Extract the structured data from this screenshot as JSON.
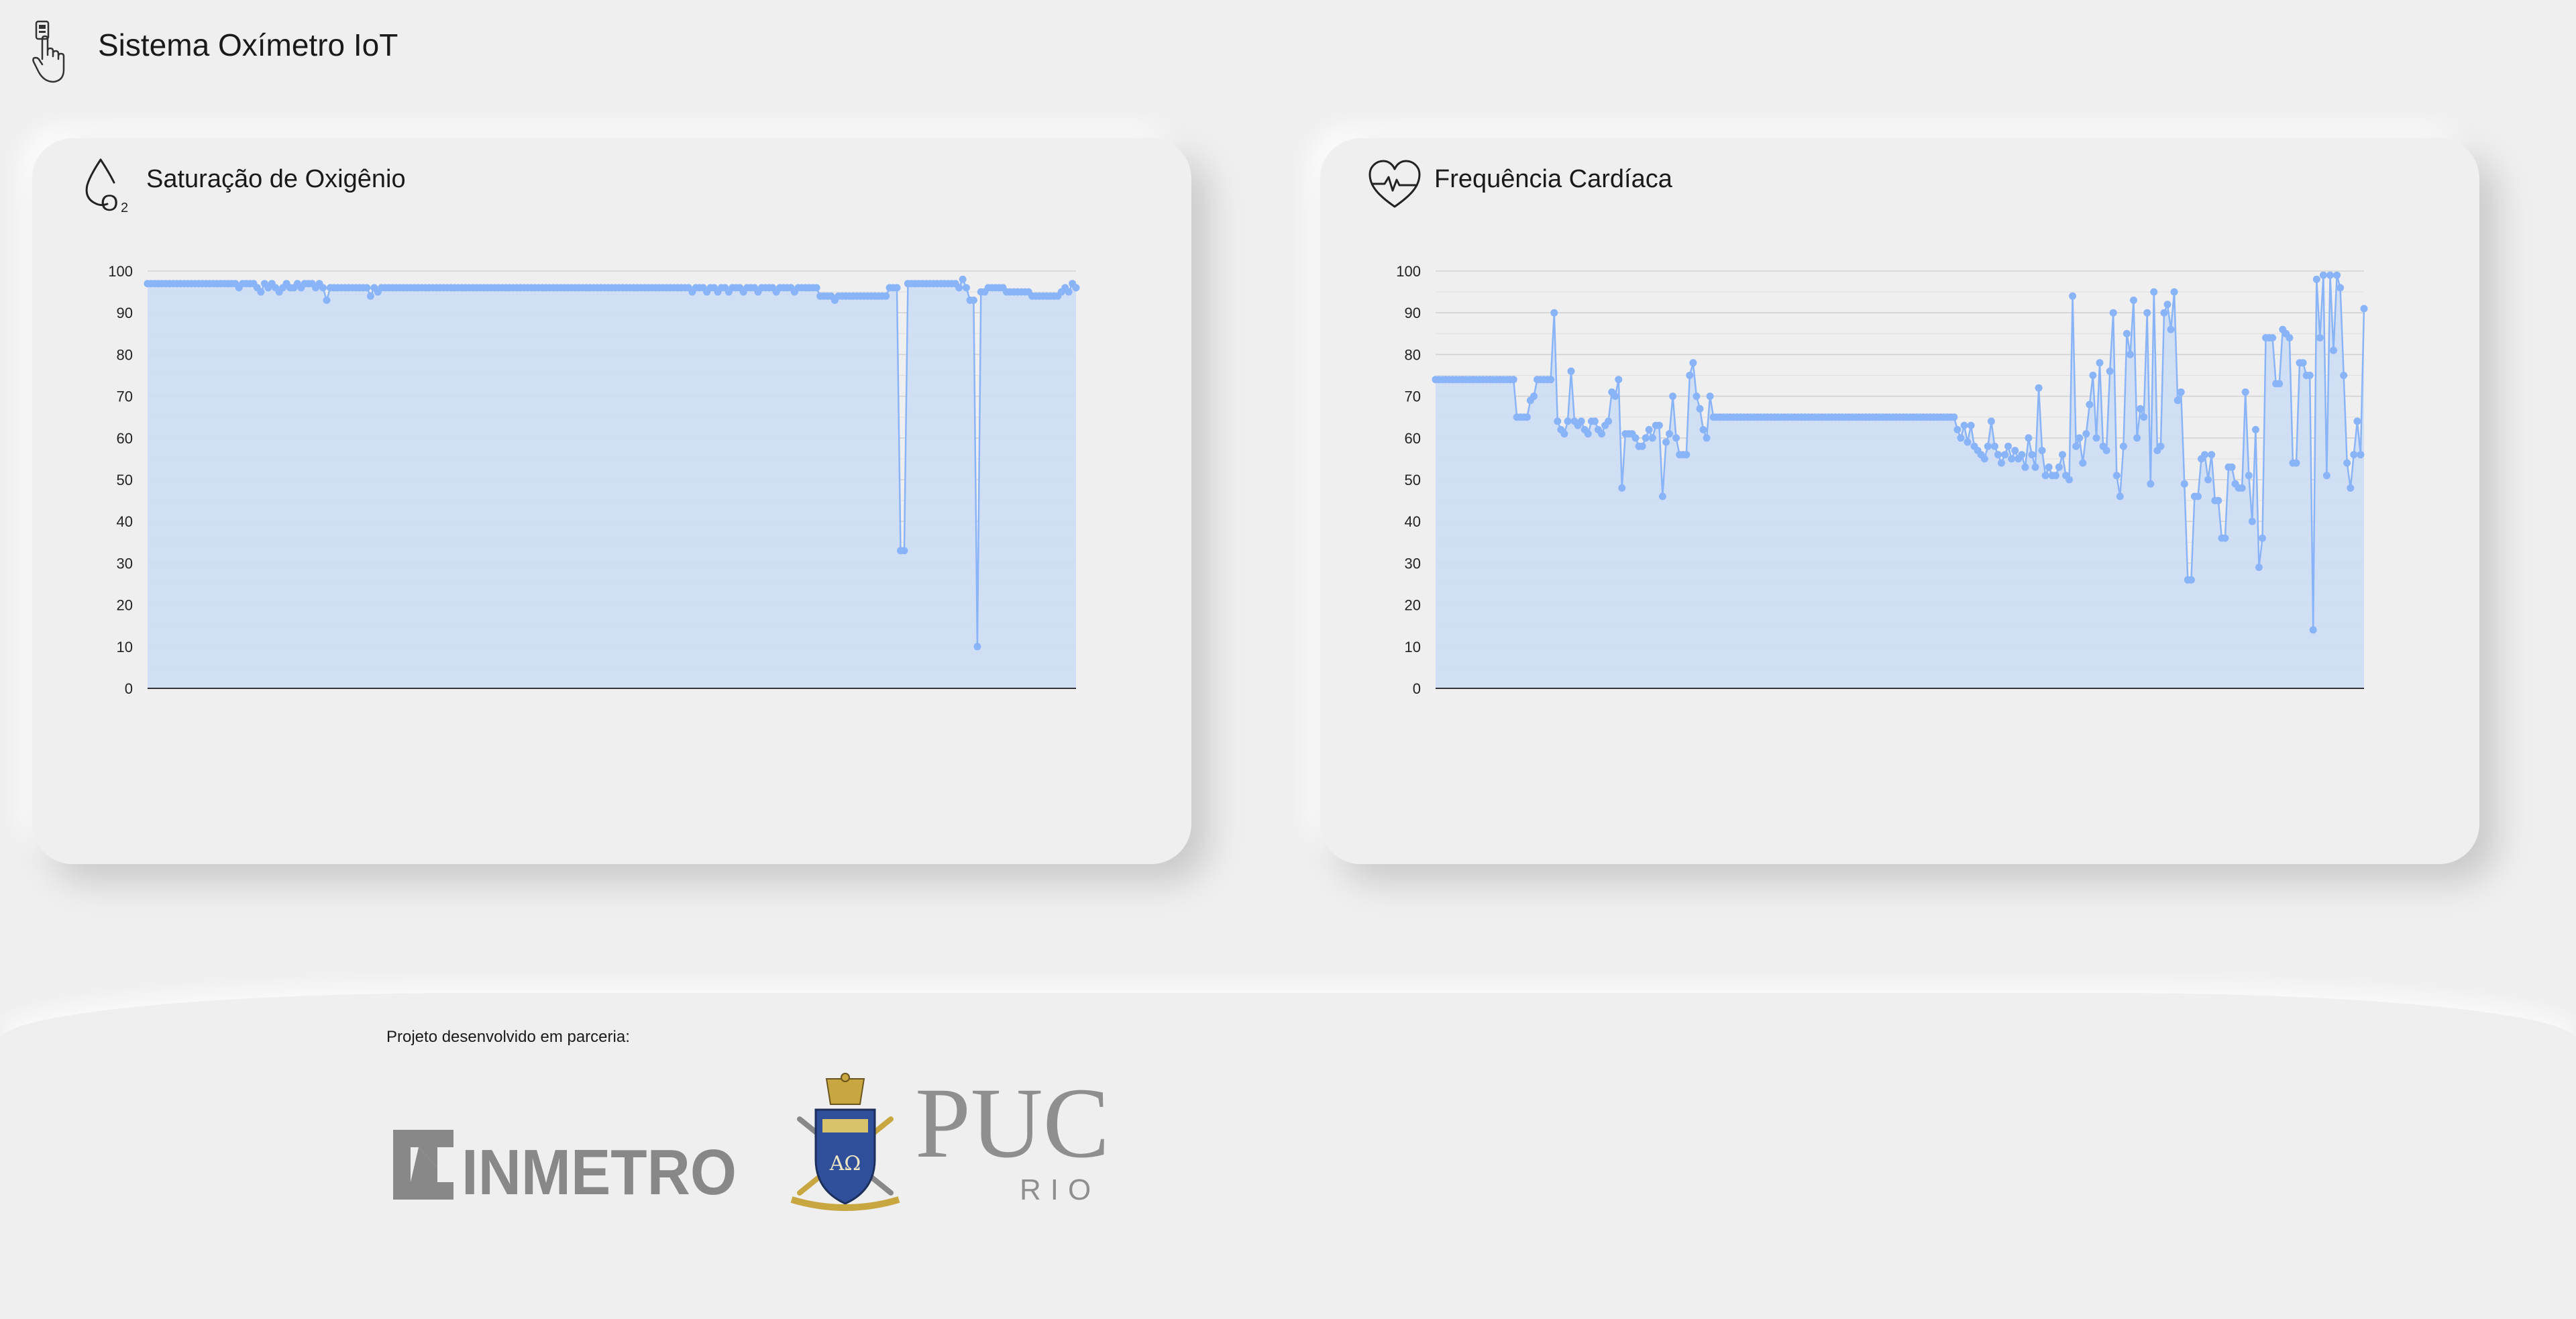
{
  "app": {
    "title": "Sistema Oxímetro IoT",
    "icon": "oximeter-finger-icon"
  },
  "cards": {
    "spo2": {
      "title": "Saturação de Oxigênio",
      "icon": "oxygen-drop-icon"
    },
    "heart": {
      "title": "Frequência Cardíaca",
      "icon": "heart-pulse-icon"
    }
  },
  "footer": {
    "caption": "Projeto desenvolvido em parceria:",
    "logos": {
      "inmetro": "INMETRO",
      "puc": "PUC",
      "puc_sub": "RIO",
      "puc_crest_motto": "ΑΩ"
    }
  },
  "colors": {
    "series": "#8ab4f8",
    "fill": "#cfddf4",
    "grid": "#cfcfcf",
    "axis": "#333333"
  },
  "chart_data": [
    {
      "type": "area",
      "title": "Saturação de Oxigênio",
      "xlabel": "",
      "ylabel": "",
      "ylim": [
        0,
        100
      ],
      "yticks": [
        0,
        10,
        20,
        30,
        40,
        50,
        60,
        70,
        80,
        90,
        100
      ],
      "grid": true,
      "series": [
        {
          "values": [
            97,
            97,
            97,
            97,
            97,
            97,
            97,
            97,
            97,
            97,
            97,
            97,
            97,
            97,
            97,
            97,
            97,
            97,
            97,
            97,
            97,
            97,
            97,
            97,
            97,
            96,
            97,
            97,
            97,
            97,
            96,
            95,
            97,
            96,
            97,
            96,
            95,
            96,
            97,
            96,
            96,
            97,
            96,
            97,
            97,
            97,
            96,
            97,
            96,
            93,
            96,
            96,
            96,
            96,
            96,
            96,
            96,
            96,
            96,
            96,
            96,
            94,
            96,
            95,
            96,
            96,
            96,
            96,
            96,
            96,
            96,
            96,
            96,
            96,
            96,
            96,
            96,
            96,
            96,
            96,
            96,
            96,
            96,
            96,
            96,
            96,
            96,
            96,
            96,
            96,
            96,
            96,
            96,
            96,
            96,
            96,
            96,
            96,
            96,
            96,
            96,
            96,
            96,
            96,
            96,
            96,
            96,
            96,
            96,
            96,
            96,
            96,
            96,
            96,
            96,
            96,
            96,
            96,
            96,
            96,
            96,
            96,
            96,
            96,
            96,
            96,
            96,
            96,
            96,
            96,
            96,
            96,
            96,
            96,
            96,
            96,
            96,
            96,
            96,
            96,
            96,
            96,
            96,
            96,
            96,
            96,
            96,
            96,
            96,
            95,
            96,
            96,
            96,
            95,
            96,
            96,
            95,
            96,
            96,
            95,
            96,
            96,
            96,
            95,
            96,
            96,
            96,
            95,
            96,
            96,
            96,
            96,
            95,
            96,
            96,
            96,
            96,
            95,
            96,
            96,
            96,
            96,
            96,
            96,
            94,
            94,
            94,
            94,
            93,
            94,
            94,
            94,
            94,
            94,
            94,
            94,
            94,
            94,
            94,
            94,
            94,
            94,
            94,
            96,
            96,
            96,
            33,
            33,
            97,
            97,
            97,
            97,
            97,
            97,
            97,
            97,
            97,
            97,
            97,
            97,
            97,
            97,
            96,
            98,
            96,
            93,
            93,
            10,
            95,
            95,
            96,
            96,
            96,
            96,
            96,
            95,
            95,
            95,
            95,
            95,
            95,
            95,
            94,
            94,
            94,
            94,
            94,
            94,
            94,
            94,
            95,
            96,
            95,
            97,
            96
          ]
        }
      ]
    },
    {
      "type": "area",
      "title": "Frequência Cardíaca",
      "xlabel": "",
      "ylabel": "",
      "ylim": [
        0,
        100
      ],
      "yticks": [
        0,
        10,
        20,
        30,
        40,
        50,
        60,
        70,
        80,
        90,
        100
      ],
      "grid": true,
      "series": [
        {
          "values": [
            74,
            74,
            74,
            74,
            74,
            74,
            74,
            74,
            74,
            74,
            74,
            74,
            74,
            74,
            74,
            74,
            74,
            74,
            74,
            74,
            74,
            74,
            74,
            74,
            65,
            65,
            65,
            65,
            69,
            70,
            74,
            74,
            74,
            74,
            74,
            90,
            64,
            62,
            61,
            64,
            76,
            64,
            63,
            64,
            62,
            61,
            64,
            64,
            62,
            61,
            63,
            64,
            71,
            70,
            74,
            48,
            61,
            61,
            61,
            60,
            58,
            58,
            60,
            62,
            60,
            63,
            63,
            46,
            59,
            61,
            70,
            60,
            56,
            56,
            56,
            75,
            78,
            70,
            67,
            62,
            60,
            70,
            65,
            65,
            65,
            65,
            65,
            65,
            65,
            65,
            65,
            65,
            65,
            65,
            65,
            65,
            65,
            65,
            65,
            65,
            65,
            65,
            65,
            65,
            65,
            65,
            65,
            65,
            65,
            65,
            65,
            65,
            65,
            65,
            65,
            65,
            65,
            65,
            65,
            65,
            65,
            65,
            65,
            65,
            65,
            65,
            65,
            65,
            65,
            65,
            65,
            65,
            65,
            65,
            65,
            65,
            65,
            65,
            65,
            65,
            65,
            65,
            65,
            65,
            65,
            65,
            65,
            65,
            65,
            65,
            65,
            65,
            65,
            65,
            62,
            60,
            63,
            59,
            63,
            58,
            57,
            56,
            55,
            58,
            64,
            58,
            56,
            54,
            56,
            58,
            55,
            57,
            55,
            56,
            53,
            60,
            56,
            53,
            72,
            57,
            51,
            53,
            51,
            51,
            53,
            56,
            51,
            50,
            94,
            58,
            60,
            54,
            61,
            68,
            75,
            60,
            78,
            58,
            57,
            76,
            90,
            51,
            46,
            58,
            85,
            80,
            93,
            60,
            67,
            65,
            90,
            49,
            95,
            57,
            58,
            90,
            92,
            86,
            95,
            69,
            71,
            49,
            26,
            26,
            46,
            46,
            55,
            56,
            50,
            56,
            45,
            45,
            36,
            36,
            53,
            53,
            49,
            48,
            48,
            71,
            51,
            40,
            62,
            29,
            36,
            84,
            84,
            84,
            73,
            73,
            86,
            85,
            84,
            54,
            54,
            78,
            78,
            75,
            75,
            14,
            98,
            84,
            99,
            51,
            99,
            81,
            99,
            96,
            75,
            54,
            48,
            56,
            64,
            56,
            91
          ]
        }
      ]
    }
  ]
}
